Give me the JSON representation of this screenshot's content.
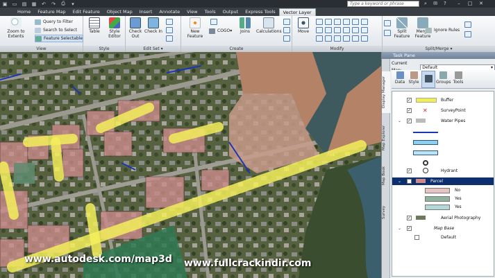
{
  "titlebar": {
    "search_placeholder": "Type a keyword or phrase"
  },
  "ribbon": {
    "tabs": [
      "Home",
      "Feature Map",
      "Edit Feature",
      "Object Map",
      "Insert",
      "Annotate",
      "View",
      "Tools",
      "Output",
      "Express Tools",
      "Vector Layer"
    ],
    "active_tab": "Vector Layer",
    "view": {
      "title": "View",
      "zoom_to_extents": "Zoom to Extents",
      "query_to_filter": "Query to Filter",
      "search_to_select": "Search to Select",
      "feature_selectable": "Feature Selectable"
    },
    "style": {
      "title": "Style",
      "table": "Table",
      "style_editor": "Style Editor"
    },
    "edit_set": {
      "title": "Edit Set",
      "check_out": "Check Out",
      "check_in": "Check In"
    },
    "create": {
      "title": "Create",
      "new_feature": "New Feature",
      "cogo": "COGO",
      "joins": "Joins",
      "calculations": "Calculations"
    },
    "modify": {
      "title": "Modify",
      "move": "Move"
    },
    "split_merge": {
      "title": "Split/Merge",
      "split_feature": "Split Feature",
      "merge_feature": "Merge Feature",
      "ignore_rules": "Ignore Rules"
    }
  },
  "taskpane": {
    "title": "Task Pane",
    "current_map_label": "Current Map:",
    "current_map_value": "Default",
    "vertical_tabs": [
      "Display Manager",
      "Map Explorer",
      "Map Book",
      "Survey"
    ],
    "toolbar": [
      "Data",
      "Style",
      "Groups",
      "Tools"
    ],
    "layers": [
      {
        "name": "Buffer",
        "checked": true
      },
      {
        "name": "SurveyPoint",
        "checked": true
      },
      {
        "name": "Water Pipes",
        "checked": true
      },
      {
        "name": "Hydrant",
        "checked": true
      },
      {
        "name": "Parcel",
        "checked": true,
        "selected": true
      },
      {
        "name": "Aerial Photography",
        "checked": true
      },
      {
        "name": "Map Base",
        "checked": true
      },
      {
        "name": "Default",
        "checked": false
      }
    ],
    "parcel_legend": [
      "No",
      "Yes",
      "Yes"
    ],
    "colors": {
      "buffer": "#f2ee5a",
      "pipe": "#1a36b8",
      "parcel_no": "#e7c4c4",
      "parcel_yes1": "#8fb39e",
      "parcel_yes2": "#b4d8d8"
    }
  },
  "watermarks": [
    "www.autodesk.com/map3d",
    "www.fullcrackindir.com"
  ]
}
